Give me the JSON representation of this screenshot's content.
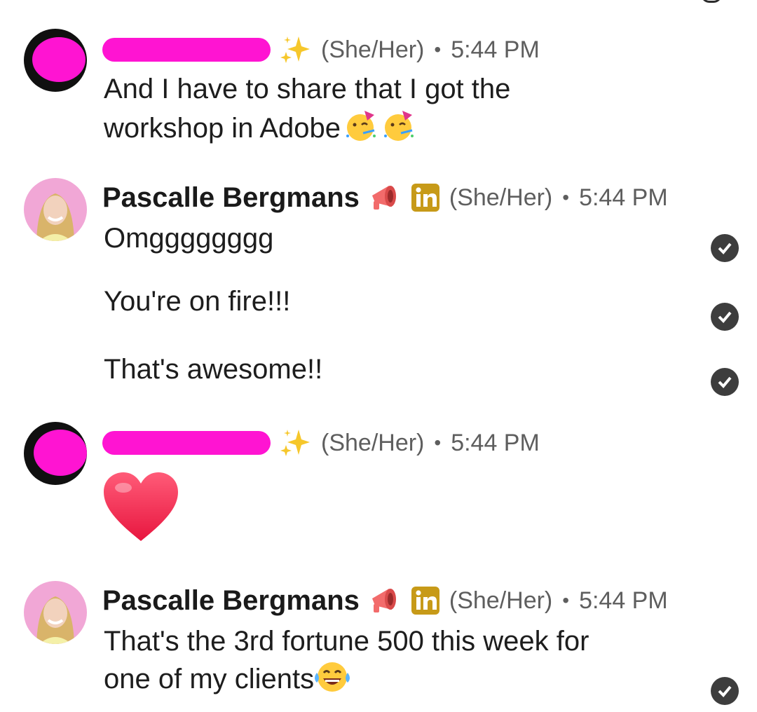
{
  "messages": [
    {
      "sender_redacted": true,
      "pronouns": "(She/Her)",
      "separator": "•",
      "time": "5:44 PM",
      "lines": [
        "And I have to share that I got the",
        "workshop in Adobe"
      ],
      "emoji": [
        "partying-face",
        "partying-face"
      ]
    },
    {
      "name": "Pascalle Bergmans",
      "pronouns": "(She/Her)",
      "separator": "•",
      "time": "5:44 PM",
      "paragraphs": [
        "Omgggggggg",
        "You're on fire!!!",
        "That's awesome!!"
      ]
    },
    {
      "sender_redacted": true,
      "pronouns": "(She/Her)",
      "separator": "•",
      "time": "5:44 PM",
      "emoji": "red-heart"
    },
    {
      "name": "Pascalle Bergmans",
      "pronouns": "(She/Her)",
      "separator": "•",
      "time": "5:44 PM",
      "lines": [
        "That's the 3rd fortune 500 this week for",
        "one of my clients"
      ],
      "emoji": "tears-of-joy-face"
    }
  ],
  "icons": {
    "sparkles": "sparkles-icon",
    "megaphone": "megaphone-icon",
    "linkedin": "linkedin-icon",
    "read_receipt": "read-receipt-icon"
  },
  "colors": {
    "redaction": "#ff14d2",
    "linkedin_badge": "#c79a18",
    "check_bg": "#3d3d3d",
    "meta_text": "#5e5e5e"
  }
}
